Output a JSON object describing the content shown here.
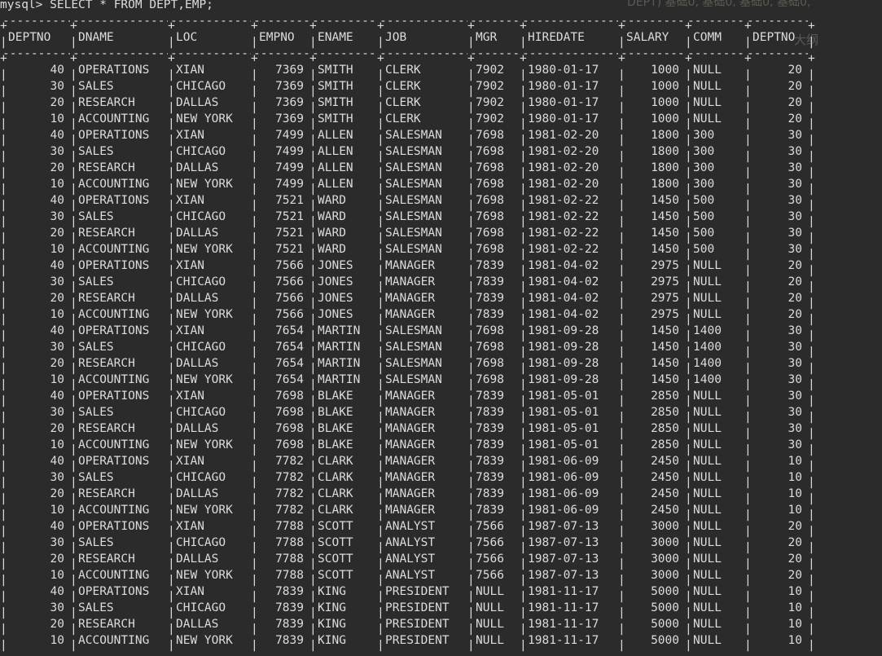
{
  "terminal": {
    "prompt": "mysql>",
    "command": "SELECT * FROM DEPT,EMP;"
  },
  "columns": [
    {
      "name": "DEPTNO",
      "align": "right"
    },
    {
      "name": "DNAME",
      "align": "left"
    },
    {
      "name": "LOC",
      "align": "left"
    },
    {
      "name": "EMPNO",
      "align": "right"
    },
    {
      "name": "ENAME",
      "align": "left"
    },
    {
      "name": "JOB",
      "align": "left"
    },
    {
      "name": "MGR",
      "align": "left"
    },
    {
      "name": "HIREDATE",
      "align": "left"
    },
    {
      "name": "SALARY",
      "align": "right"
    },
    {
      "name": "COMM",
      "align": "left"
    },
    {
      "name": "DEPTNO",
      "align": "right"
    }
  ],
  "rows": [
    [
      "40",
      "OPERATIONS",
      "XIAN",
      "7369",
      "SMITH",
      "CLERK",
      "7902",
      "1980-01-17",
      "1000",
      "NULL",
      "20"
    ],
    [
      "30",
      "SALES",
      "CHICAGO",
      "7369",
      "SMITH",
      "CLERK",
      "7902",
      "1980-01-17",
      "1000",
      "NULL",
      "20"
    ],
    [
      "20",
      "RESEARCH",
      "DALLAS",
      "7369",
      "SMITH",
      "CLERK",
      "7902",
      "1980-01-17",
      "1000",
      "NULL",
      "20"
    ],
    [
      "10",
      "ACCOUNTING",
      "NEW YORK",
      "7369",
      "SMITH",
      "CLERK",
      "7902",
      "1980-01-17",
      "1000",
      "NULL",
      "20"
    ],
    [
      "40",
      "OPERATIONS",
      "XIAN",
      "7499",
      "ALLEN",
      "SALESMAN",
      "7698",
      "1981-02-20",
      "1800",
      "300",
      "30"
    ],
    [
      "30",
      "SALES",
      "CHICAGO",
      "7499",
      "ALLEN",
      "SALESMAN",
      "7698",
      "1981-02-20",
      "1800",
      "300",
      "30"
    ],
    [
      "20",
      "RESEARCH",
      "DALLAS",
      "7499",
      "ALLEN",
      "SALESMAN",
      "7698",
      "1981-02-20",
      "1800",
      "300",
      "30"
    ],
    [
      "10",
      "ACCOUNTING",
      "NEW YORK",
      "7499",
      "ALLEN",
      "SALESMAN",
      "7698",
      "1981-02-20",
      "1800",
      "300",
      "30"
    ],
    [
      "40",
      "OPERATIONS",
      "XIAN",
      "7521",
      "WARD",
      "SALESMAN",
      "7698",
      "1981-02-22",
      "1450",
      "500",
      "30"
    ],
    [
      "30",
      "SALES",
      "CHICAGO",
      "7521",
      "WARD",
      "SALESMAN",
      "7698",
      "1981-02-22",
      "1450",
      "500",
      "30"
    ],
    [
      "20",
      "RESEARCH",
      "DALLAS",
      "7521",
      "WARD",
      "SALESMAN",
      "7698",
      "1981-02-22",
      "1450",
      "500",
      "30"
    ],
    [
      "10",
      "ACCOUNTING",
      "NEW YORK",
      "7521",
      "WARD",
      "SALESMAN",
      "7698",
      "1981-02-22",
      "1450",
      "500",
      "30"
    ],
    [
      "40",
      "OPERATIONS",
      "XIAN",
      "7566",
      "JONES",
      "MANAGER",
      "7839",
      "1981-04-02",
      "2975",
      "NULL",
      "20"
    ],
    [
      "30",
      "SALES",
      "CHICAGO",
      "7566",
      "JONES",
      "MANAGER",
      "7839",
      "1981-04-02",
      "2975",
      "NULL",
      "20"
    ],
    [
      "20",
      "RESEARCH",
      "DALLAS",
      "7566",
      "JONES",
      "MANAGER",
      "7839",
      "1981-04-02",
      "2975",
      "NULL",
      "20"
    ],
    [
      "10",
      "ACCOUNTING",
      "NEW YORK",
      "7566",
      "JONES",
      "MANAGER",
      "7839",
      "1981-04-02",
      "2975",
      "NULL",
      "20"
    ],
    [
      "40",
      "OPERATIONS",
      "XIAN",
      "7654",
      "MARTIN",
      "SALESMAN",
      "7698",
      "1981-09-28",
      "1450",
      "1400",
      "30"
    ],
    [
      "30",
      "SALES",
      "CHICAGO",
      "7654",
      "MARTIN",
      "SALESMAN",
      "7698",
      "1981-09-28",
      "1450",
      "1400",
      "30"
    ],
    [
      "20",
      "RESEARCH",
      "DALLAS",
      "7654",
      "MARTIN",
      "SALESMAN",
      "7698",
      "1981-09-28",
      "1450",
      "1400",
      "30"
    ],
    [
      "10",
      "ACCOUNTING",
      "NEW YORK",
      "7654",
      "MARTIN",
      "SALESMAN",
      "7698",
      "1981-09-28",
      "1450",
      "1400",
      "30"
    ],
    [
      "40",
      "OPERATIONS",
      "XIAN",
      "7698",
      "BLAKE",
      "MANAGER",
      "7839",
      "1981-05-01",
      "2850",
      "NULL",
      "30"
    ],
    [
      "30",
      "SALES",
      "CHICAGO",
      "7698",
      "BLAKE",
      "MANAGER",
      "7839",
      "1981-05-01",
      "2850",
      "NULL",
      "30"
    ],
    [
      "20",
      "RESEARCH",
      "DALLAS",
      "7698",
      "BLAKE",
      "MANAGER",
      "7839",
      "1981-05-01",
      "2850",
      "NULL",
      "30"
    ],
    [
      "10",
      "ACCOUNTING",
      "NEW YORK",
      "7698",
      "BLAKE",
      "MANAGER",
      "7839",
      "1981-05-01",
      "2850",
      "NULL",
      "30"
    ],
    [
      "40",
      "OPERATIONS",
      "XIAN",
      "7782",
      "CLARK",
      "MANAGER",
      "7839",
      "1981-06-09",
      "2450",
      "NULL",
      "10"
    ],
    [
      "30",
      "SALES",
      "CHICAGO",
      "7782",
      "CLARK",
      "MANAGER",
      "7839",
      "1981-06-09",
      "2450",
      "NULL",
      "10"
    ],
    [
      "20",
      "RESEARCH",
      "DALLAS",
      "7782",
      "CLARK",
      "MANAGER",
      "7839",
      "1981-06-09",
      "2450",
      "NULL",
      "10"
    ],
    [
      "10",
      "ACCOUNTING",
      "NEW YORK",
      "7782",
      "CLARK",
      "MANAGER",
      "7839",
      "1981-06-09",
      "2450",
      "NULL",
      "10"
    ],
    [
      "40",
      "OPERATIONS",
      "XIAN",
      "7788",
      "SCOTT",
      "ANALYST",
      "7566",
      "1987-07-13",
      "3000",
      "NULL",
      "20"
    ],
    [
      "30",
      "SALES",
      "CHICAGO",
      "7788",
      "SCOTT",
      "ANALYST",
      "7566",
      "1987-07-13",
      "3000",
      "NULL",
      "20"
    ],
    [
      "20",
      "RESEARCH",
      "DALLAS",
      "7788",
      "SCOTT",
      "ANALYST",
      "7566",
      "1987-07-13",
      "3000",
      "NULL",
      "20"
    ],
    [
      "10",
      "ACCOUNTING",
      "NEW YORK",
      "7788",
      "SCOTT",
      "ANALYST",
      "7566",
      "1987-07-13",
      "3000",
      "NULL",
      "20"
    ],
    [
      "40",
      "OPERATIONS",
      "XIAN",
      "7839",
      "KING",
      "PRESIDENT",
      "NULL",
      "1981-11-17",
      "5000",
      "NULL",
      "10"
    ],
    [
      "30",
      "SALES",
      "CHICAGO",
      "7839",
      "KING",
      "PRESIDENT",
      "NULL",
      "1981-11-17",
      "5000",
      "NULL",
      "10"
    ],
    [
      "20",
      "RESEARCH",
      "DALLAS",
      "7839",
      "KING",
      "PRESIDENT",
      "NULL",
      "1981-11-17",
      "5000",
      "NULL",
      "10"
    ],
    [
      "10",
      "ACCOUNTING",
      "NEW YORK",
      "7839",
      "KING",
      "PRESIDENT",
      "NULL",
      "1981-11-17",
      "5000",
      "NULL",
      "10"
    ]
  ],
  "background_ghost_text": {
    "top_right": "DEPT) 基础0, 基础0, 基础0, 基础0,",
    "outline": "大纲"
  }
}
